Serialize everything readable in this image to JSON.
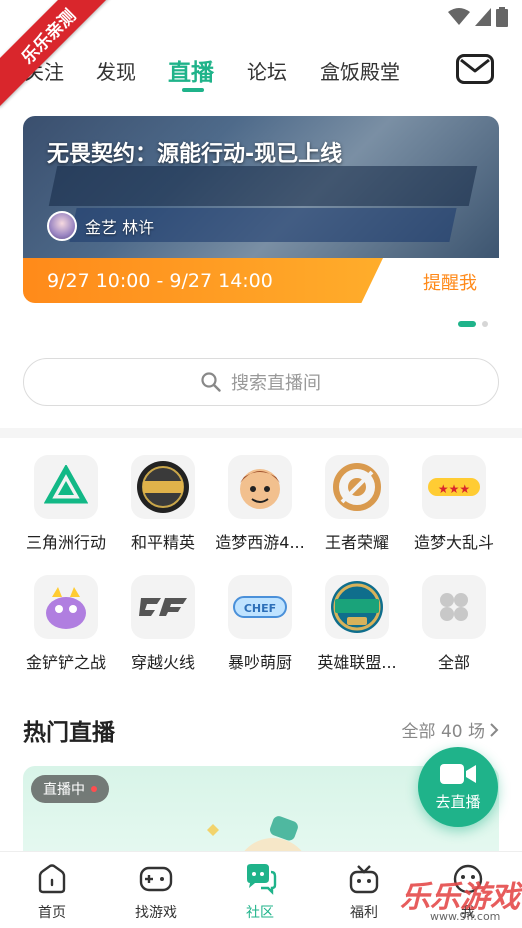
{
  "watermark": {
    "ribbon": "乐乐亲测",
    "bottom_logo": "乐乐游戏",
    "url": "www.9fl.com"
  },
  "tabs": [
    {
      "label": "关注"
    },
    {
      "label": "发现"
    },
    {
      "label": "直播",
      "active": true
    },
    {
      "label": "论坛"
    },
    {
      "label": "盒饭殿堂"
    }
  ],
  "banner": {
    "title": "无畏契约：源能行动-现已上线",
    "streamer": "金艺 林许",
    "time": "9/27 10:00 - 9/27 14:00",
    "remind_label": "提醒我"
  },
  "search": {
    "placeholder": "搜索直播间"
  },
  "games": [
    {
      "label": "三角洲行动",
      "icon": "delta-force-icon"
    },
    {
      "label": "和平精英",
      "icon": "peace-elite-icon"
    },
    {
      "label": "造梦西游4...",
      "icon": "zaomeng-xiyou-icon"
    },
    {
      "label": "王者荣耀",
      "icon": "honor-of-kings-icon"
    },
    {
      "label": "造梦大乱斗",
      "icon": "zaomeng-brawl-icon"
    },
    {
      "label": "金铲铲之战",
      "icon": "golden-spatula-icon"
    },
    {
      "label": "穿越火线",
      "icon": "crossfire-icon"
    },
    {
      "label": "暴吵萌厨",
      "icon": "cute-chef-icon"
    },
    {
      "label": "英雄联盟...",
      "icon": "league-of-legends-icon"
    },
    {
      "label": "全部",
      "icon": "all-grid-icon"
    }
  ],
  "hot": {
    "title": "热门直播",
    "more": "全部 40 场"
  },
  "live_card": {
    "badge": "直播中"
  },
  "float_button": {
    "label": "去直播"
  },
  "bottom_nav": [
    {
      "label": "首页",
      "icon": "home-icon"
    },
    {
      "label": "找游戏",
      "icon": "gamepad-icon"
    },
    {
      "label": "社区",
      "icon": "community-chat-icon",
      "active": true
    },
    {
      "label": "福利",
      "icon": "gift-icon"
    },
    {
      "label": "我",
      "icon": "profile-icon"
    }
  ],
  "colors": {
    "accent": "#1fb38a",
    "orange": "#ff8a1a",
    "ribbon": "#d9262c"
  }
}
